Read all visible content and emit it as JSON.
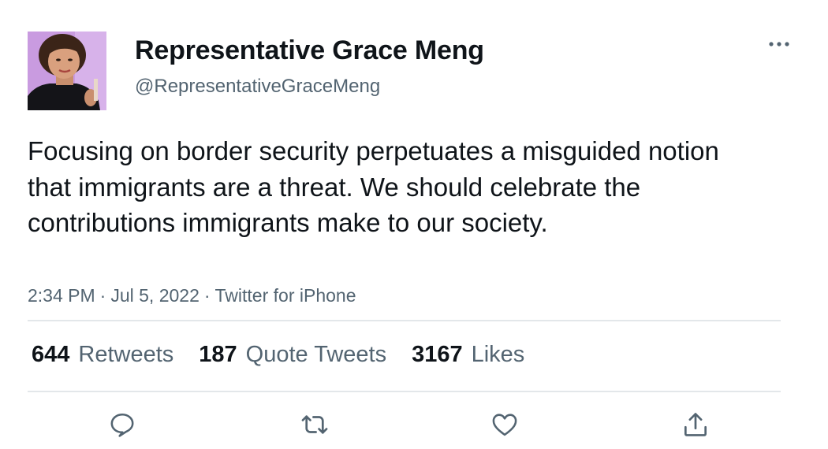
{
  "author": {
    "display_name": "Representative Grace Meng",
    "handle": "@RepresentativeGraceMeng",
    "avatar_icon": "profile-photo"
  },
  "tweet": {
    "text": "Focusing on border security perpetuates a misguided notion that immigrants are a threat. We should celebrate the contributions immigrants make to our society.",
    "time": "2:34 PM",
    "date": "Jul 5, 2022",
    "source": "Twitter for iPhone",
    "separator": "·"
  },
  "stats": {
    "retweets": {
      "count": "644",
      "label": "Retweets"
    },
    "quote_tweets": {
      "count": "187",
      "label": "Quote Tweets"
    },
    "likes": {
      "count": "3167",
      "label": "Likes"
    }
  },
  "actions": [
    {
      "icon": "reply-icon"
    },
    {
      "icon": "retweet-icon"
    },
    {
      "icon": "like-icon"
    },
    {
      "icon": "share-icon"
    }
  ],
  "more_icon": "more-icon",
  "colors": {
    "text_primary": "#0f1419",
    "text_secondary": "#536471",
    "divider": "#e3e7ea",
    "avatar_background": "#c99be0"
  }
}
